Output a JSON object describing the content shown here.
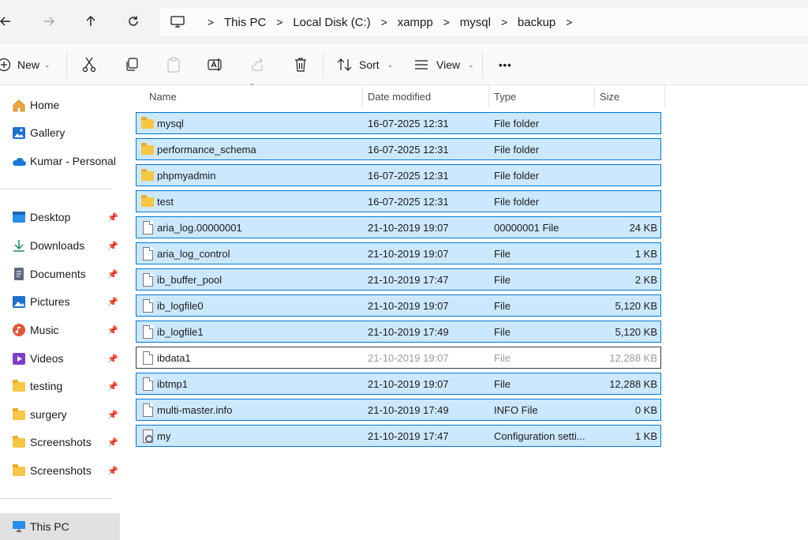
{
  "breadcrumb": {
    "items": [
      "This PC",
      "Local Disk (C:)",
      "xampp",
      "mysql",
      "backup"
    ],
    "separator": ">"
  },
  "toolbar": {
    "new_label": "New",
    "sort_label": "Sort",
    "view_label": "View",
    "more_label": "•••"
  },
  "nav": {
    "top": [
      {
        "label": "Home",
        "icon": "home-icon"
      },
      {
        "label": "Gallery",
        "icon": "gallery-icon"
      },
      {
        "label": "Kumar - Personal",
        "icon": "onedrive-cloud-icon"
      }
    ],
    "pinned": [
      {
        "label": "Desktop",
        "icon": "desktop-icon"
      },
      {
        "label": "Downloads",
        "icon": "downloads-icon"
      },
      {
        "label": "Documents",
        "icon": "documents-icon"
      },
      {
        "label": "Pictures",
        "icon": "pictures-icon"
      },
      {
        "label": "Music",
        "icon": "music-icon"
      },
      {
        "label": "Videos",
        "icon": "videos-icon"
      },
      {
        "label": "testing",
        "icon": "folder-icon"
      },
      {
        "label": "surgery",
        "icon": "folder-icon"
      },
      {
        "label": "Screenshots",
        "icon": "folder-icon"
      },
      {
        "label": "Screenshots",
        "icon": "folder-icon"
      }
    ],
    "this_pc": {
      "label": "This PC",
      "icon": "monitor-icon"
    }
  },
  "columns": {
    "name": "Name",
    "date": "Date modified",
    "type": "Type",
    "size": "Size"
  },
  "files": [
    {
      "name": "mysql",
      "date": "16-07-2025 12:31",
      "type": "File folder",
      "size": "",
      "kind": "folder",
      "selected": true
    },
    {
      "name": "performance_schema",
      "date": "16-07-2025 12:31",
      "type": "File folder",
      "size": "",
      "kind": "folder",
      "selected": true
    },
    {
      "name": "phpmyadmin",
      "date": "16-07-2025 12:31",
      "type": "File folder",
      "size": "",
      "kind": "folder",
      "selected": true
    },
    {
      "name": "test",
      "date": "16-07-2025 12:31",
      "type": "File folder",
      "size": "",
      "kind": "folder",
      "selected": true
    },
    {
      "name": "aria_log.00000001",
      "date": "21-10-2019 19:07",
      "type": "00000001 File",
      "size": "24 KB",
      "kind": "file",
      "selected": true
    },
    {
      "name": "aria_log_control",
      "date": "21-10-2019 19:07",
      "type": "File",
      "size": "1 KB",
      "kind": "file",
      "selected": true
    },
    {
      "name": "ib_buffer_pool",
      "date": "21-10-2019 17:47",
      "type": "File",
      "size": "2 KB",
      "kind": "file",
      "selected": true
    },
    {
      "name": "ib_logfile0",
      "date": "21-10-2019 19:07",
      "type": "File",
      "size": "5,120 KB",
      "kind": "file",
      "selected": true
    },
    {
      "name": "ib_logfile1",
      "date": "21-10-2019 17:49",
      "type": "File",
      "size": "5,120 KB",
      "kind": "file",
      "selected": true
    },
    {
      "name": "ibdata1",
      "date": "21-10-2019 19:07",
      "type": "File",
      "size": "12,288 KB",
      "kind": "file",
      "selected": false
    },
    {
      "name": "ibtmp1",
      "date": "21-10-2019 19:07",
      "type": "File",
      "size": "12,288 KB",
      "kind": "file",
      "selected": true
    },
    {
      "name": "multi-master.info",
      "date": "21-10-2019 17:49",
      "type": "INFO File",
      "size": "0 KB",
      "kind": "file",
      "selected": true
    },
    {
      "name": "my",
      "date": "21-10-2019 17:47",
      "type": "Configuration setti...",
      "size": "1 KB",
      "kind": "config",
      "selected": true
    }
  ],
  "colors": {
    "selection_fill": "#cce8ff",
    "selection_border": "#0078d4",
    "folder": "#f8c645"
  }
}
